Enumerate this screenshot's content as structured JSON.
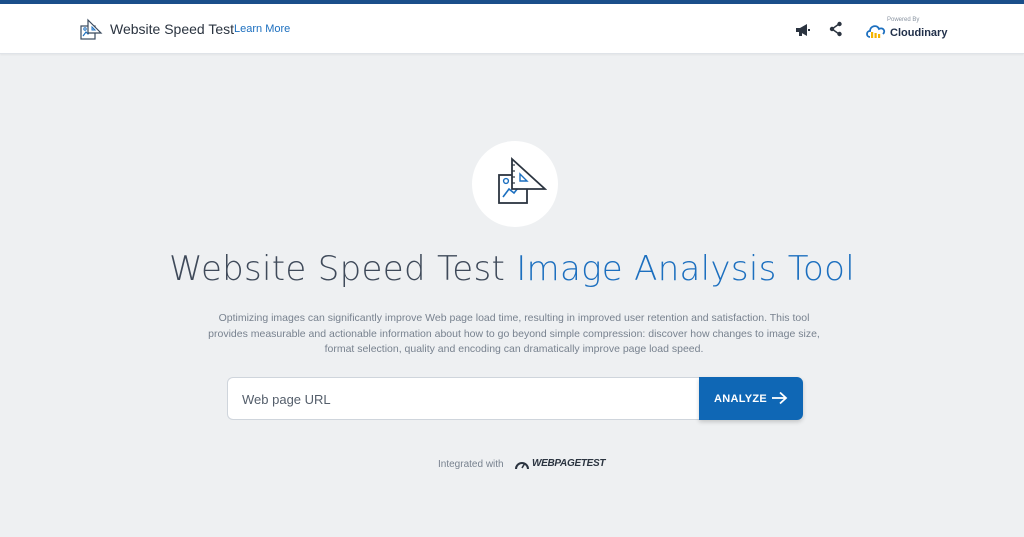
{
  "header": {
    "app_title": "Website Speed Test",
    "learn_more": "Learn More",
    "powered_by": "Powered By",
    "brand": "Cloudinary",
    "icons": [
      "speed-test-logo-icon",
      "megaphone-icon",
      "share-icon",
      "cloudinary-logo-icon"
    ]
  },
  "hero": {
    "title_main": "Website Speed Test",
    "title_accent": "Image Analysis Tool",
    "description": "Optimizing images can significantly improve Web page load time, resulting in improved user retention and satisfaction. This tool provides measurable and actionable information about how to go beyond simple compression: discover how changes to image size, format selection, quality and encoding can dramatically improve page load speed."
  },
  "search": {
    "placeholder": "Web page URL",
    "value": "",
    "button_label": "ANALYZE"
  },
  "footer": {
    "integrated_with": "Integrated with",
    "partner": "WEBPAGETEST"
  },
  "colors": {
    "accent": "#1c6fbf",
    "button": "#0f67b5",
    "top_bar": "#1a4f8a",
    "background": "#eef0f2"
  }
}
